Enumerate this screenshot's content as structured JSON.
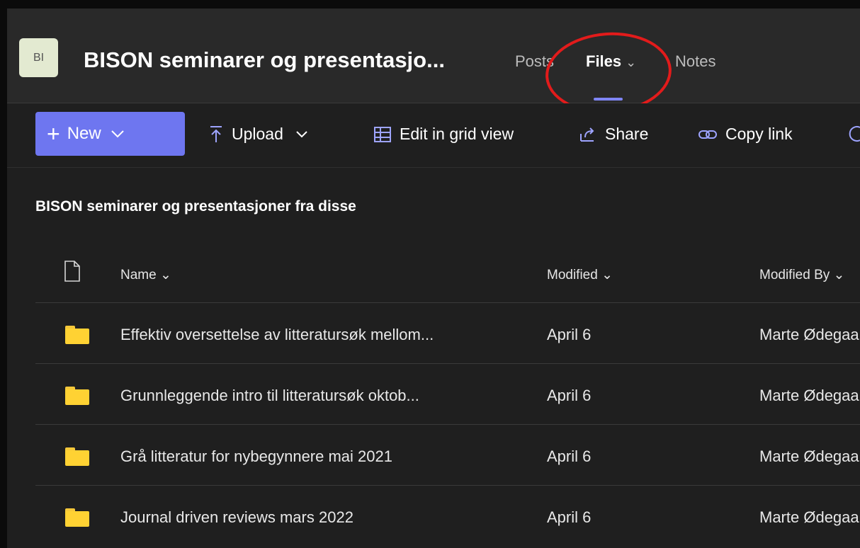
{
  "header": {
    "avatar_initials": "BI",
    "team_title": "BISON seminarer og presentasjo...",
    "tabs": [
      {
        "label": "Posts"
      },
      {
        "label": "Files",
        "chevron": "⌄"
      },
      {
        "label": "Notes"
      }
    ]
  },
  "toolbar": {
    "new_label": "New",
    "upload_label": "Upload",
    "edit_grid_label": "Edit in grid view",
    "share_label": "Share",
    "copy_link_label": "Copy link"
  },
  "folder_title": "BISON seminarer og presentasjoner fra disse",
  "columns": {
    "name": "Name ⌄",
    "modified": "Modified ⌄",
    "modified_by": "Modified By ⌄"
  },
  "rows": [
    {
      "name": "Effektiv oversettelse av litteratursøk mellom...",
      "modified": "April 6",
      "modified_by": "Marte Ødegaard"
    },
    {
      "name": "Grunnleggende intro til litteratursøk oktob...",
      "modified": "April 6",
      "modified_by": "Marte Ødegaard"
    },
    {
      "name": "Grå litteratur for nybegynnere mai 2021",
      "modified": "April 6",
      "modified_by": "Marte Ødegaard"
    },
    {
      "name": "Journal driven reviews mars 2022",
      "modified": "April 6",
      "modified_by": "Marte Ødegaard"
    }
  ],
  "colors": {
    "accent": "#6e76f0",
    "folder": "#ffd233",
    "annotation": "#e21b1b"
  }
}
